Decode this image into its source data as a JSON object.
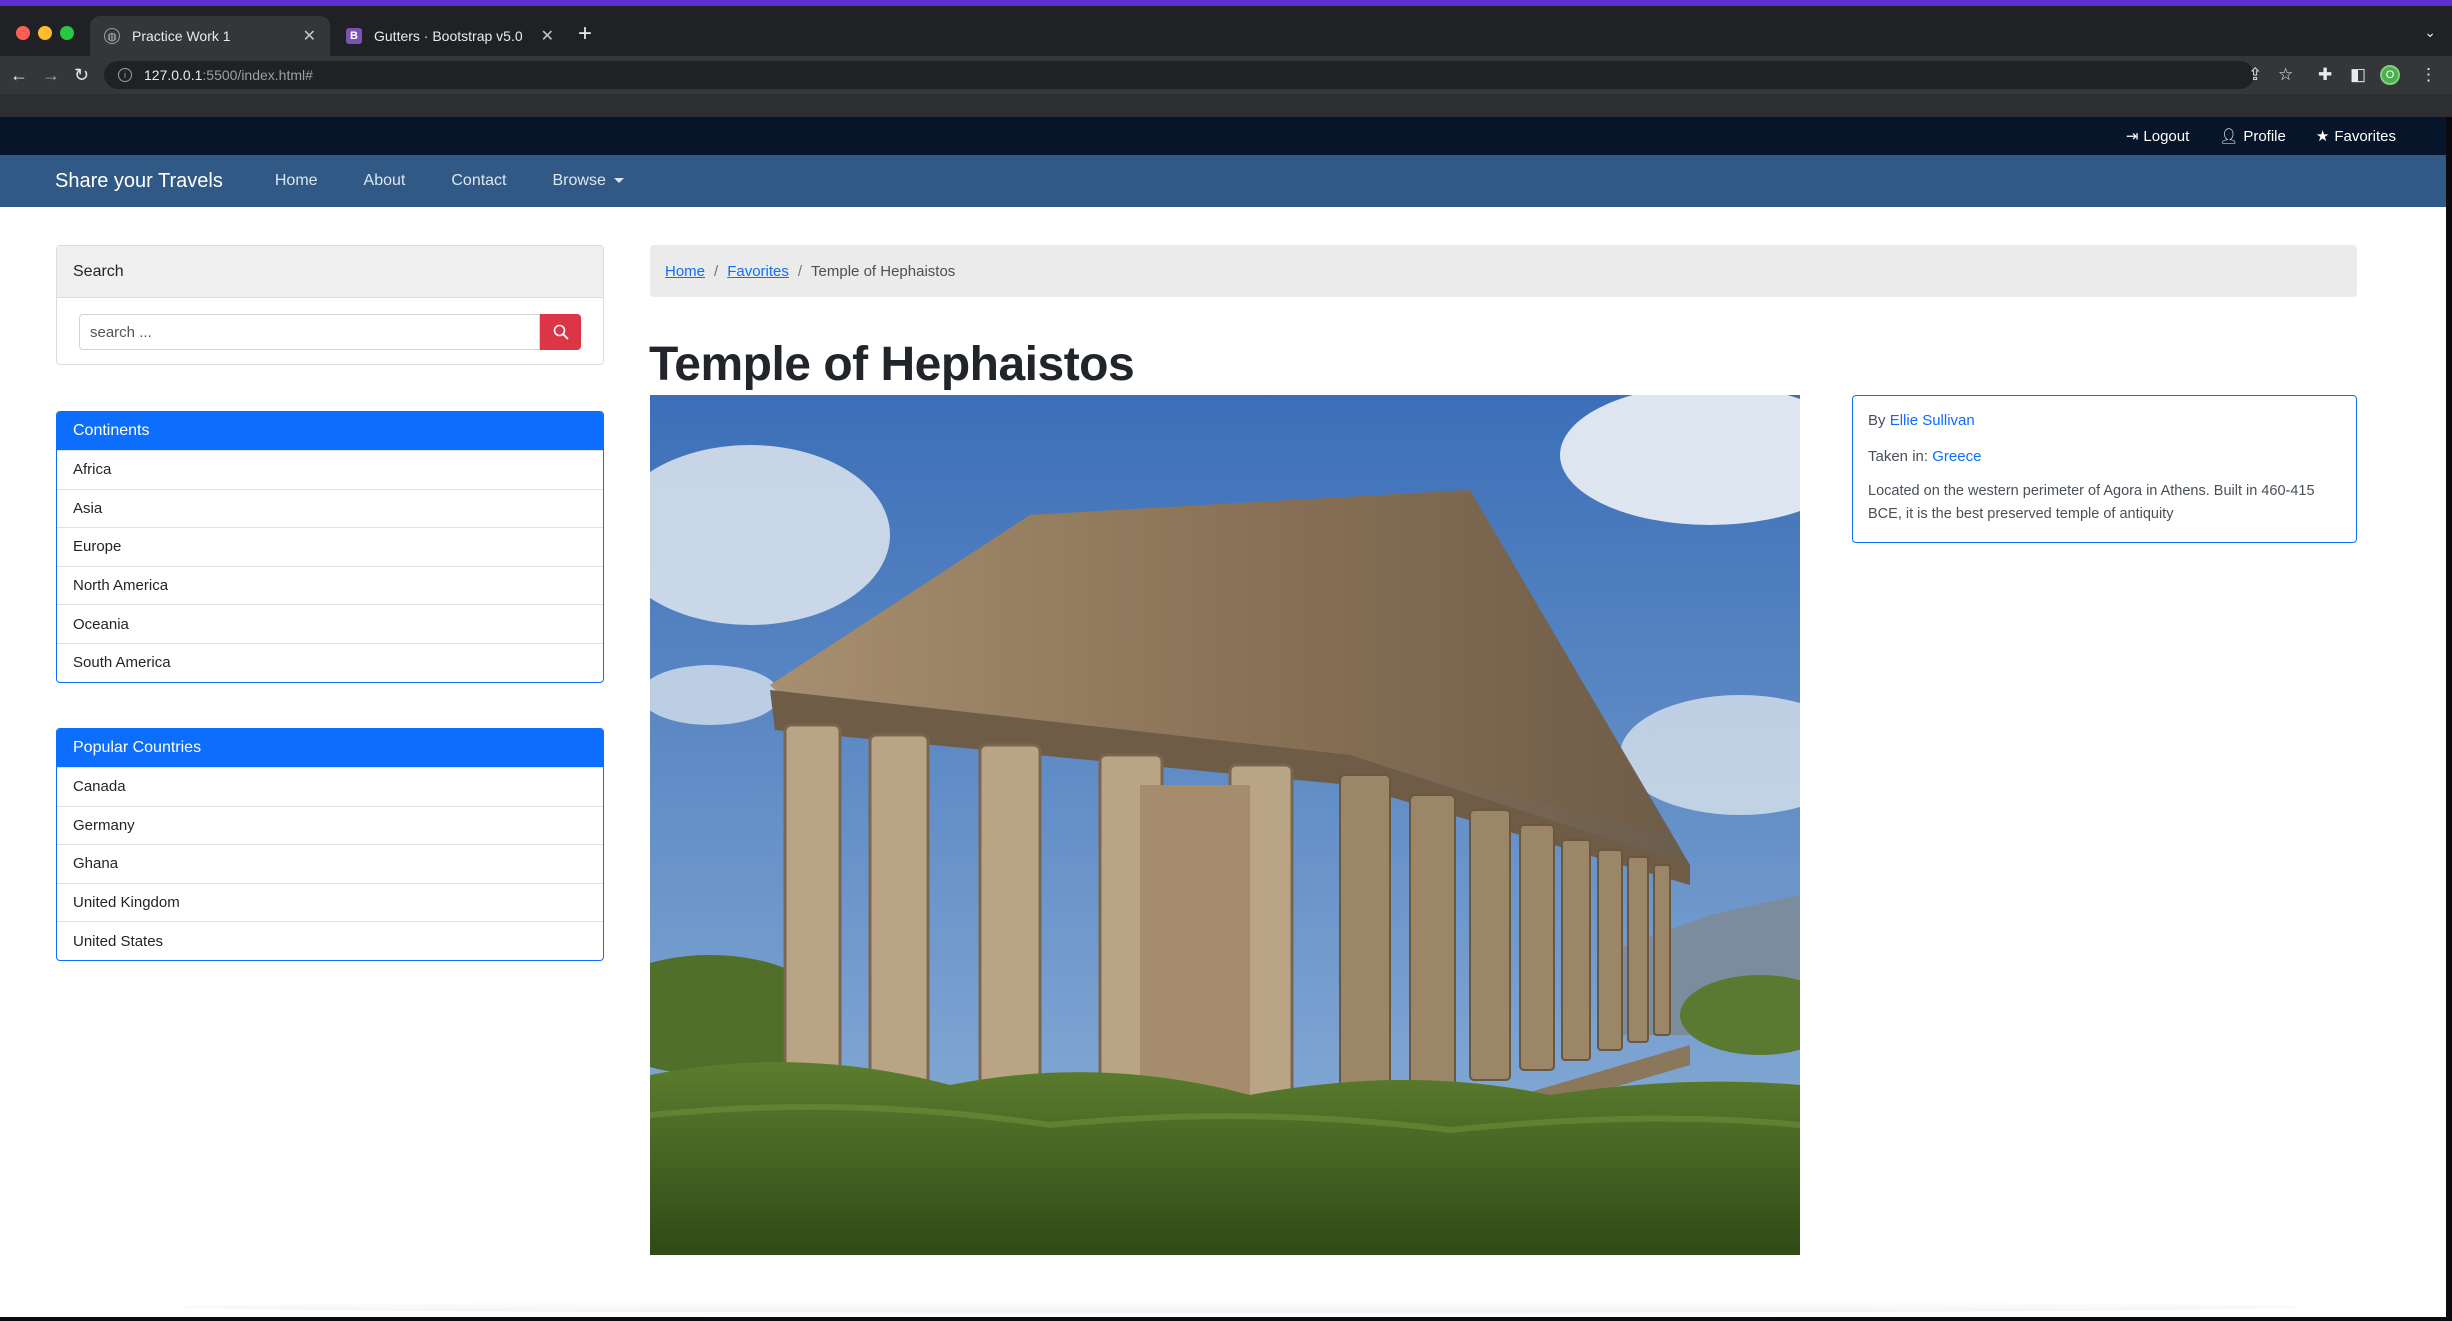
{
  "browser": {
    "tabs": [
      {
        "label": "Practice Work 1",
        "active": true,
        "favicon": "globe-icon"
      },
      {
        "label": "Gutters · Bootstrap v5.0",
        "active": false,
        "favicon": "bootstrap-icon",
        "favicon_letter": "B"
      }
    ],
    "url_host": "127.0.0.1",
    "url_path": ":5500/index.html#",
    "profile_initial": "O"
  },
  "topbar": {
    "logout": "Logout",
    "profile": "Profile",
    "favorites": "Favorites"
  },
  "nav": {
    "brand": "Share your Travels",
    "home": "Home",
    "about": "About",
    "contact": "Contact",
    "browse": "Browse"
  },
  "search": {
    "header": "Search",
    "placeholder": "search ..."
  },
  "continents": {
    "header": "Continents",
    "items": [
      "Africa",
      "Asia",
      "Europe",
      "North America",
      "Oceania",
      "South America"
    ]
  },
  "countries": {
    "header": "Popular Countries",
    "items": [
      "Canada",
      "Germany",
      "Ghana",
      "United Kingdom",
      "United States"
    ]
  },
  "breadcrumb": {
    "home": "Home",
    "favorites": "Favorites",
    "current": "Temple of Hephaistos",
    "separator": "/"
  },
  "photo": {
    "title": "Temple of Hephaistos",
    "by_label": "By",
    "author": "Ellie Sullivan",
    "taken_label": "Taken in:",
    "country": "Greece",
    "description": "Located on the western perimeter of Agora in Athens. Built in 460-415 BCE, it is the best preserved temple of antiquity"
  },
  "colors": {
    "topbar": "#07152b",
    "navbar": "#305a85",
    "primary": "#0d6efd",
    "danger": "#dc3545"
  }
}
